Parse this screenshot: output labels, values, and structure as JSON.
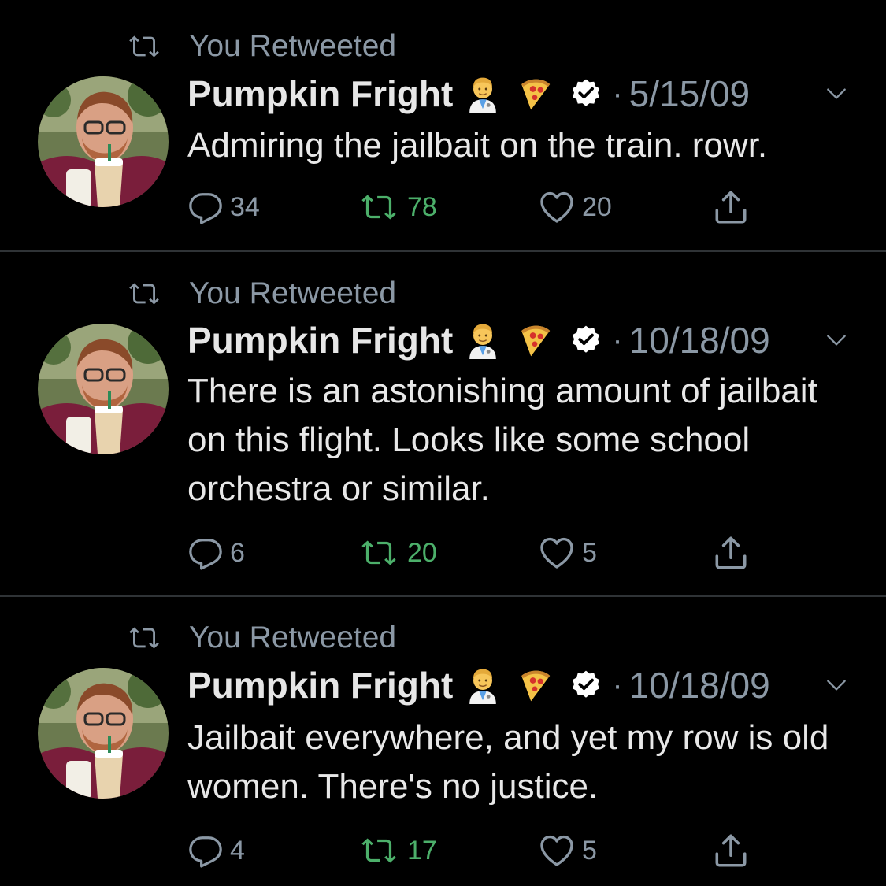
{
  "colors": {
    "background": "#000000",
    "divider": "#2f3336",
    "muted": "#8b98a5",
    "text": "#e8e8e8",
    "retweet_green": "#4caf6a",
    "verified_badge": "#ffffff"
  },
  "icons": {
    "retweeted": "retweet-icon",
    "reply": "reply-icon",
    "retweet": "retweet-icon",
    "like": "heart-icon",
    "share": "share-icon",
    "more": "chevron-down-icon",
    "verified": "verified-icon",
    "emoji_1": "health-worker-emoji",
    "emoji_2": "pizza-emoji"
  },
  "tweets": [
    {
      "retweeted_label": "You Retweeted",
      "name": "Pumpkin Fright",
      "separator": "·",
      "date": "5/15/09",
      "text": "Admiring the jailbait on the train. rowr.",
      "replies": "34",
      "retweets": "78",
      "likes": "20"
    },
    {
      "retweeted_label": "You Retweeted",
      "name": "Pumpkin Fright",
      "separator": "·",
      "date": "10/18/09",
      "text": "There is an astonishing amount of jailbait on this flight. Looks like some school orchestra or similar.",
      "replies": "6",
      "retweets": "20",
      "likes": "5"
    },
    {
      "retweeted_label": "You Retweeted",
      "name": "Pumpkin Fright",
      "separator": "·",
      "date": "10/18/09",
      "text": "Jailbait everywhere, and yet my row is old women. There's no justice.",
      "replies": "4",
      "retweets": "17",
      "likes": "5"
    }
  ]
}
